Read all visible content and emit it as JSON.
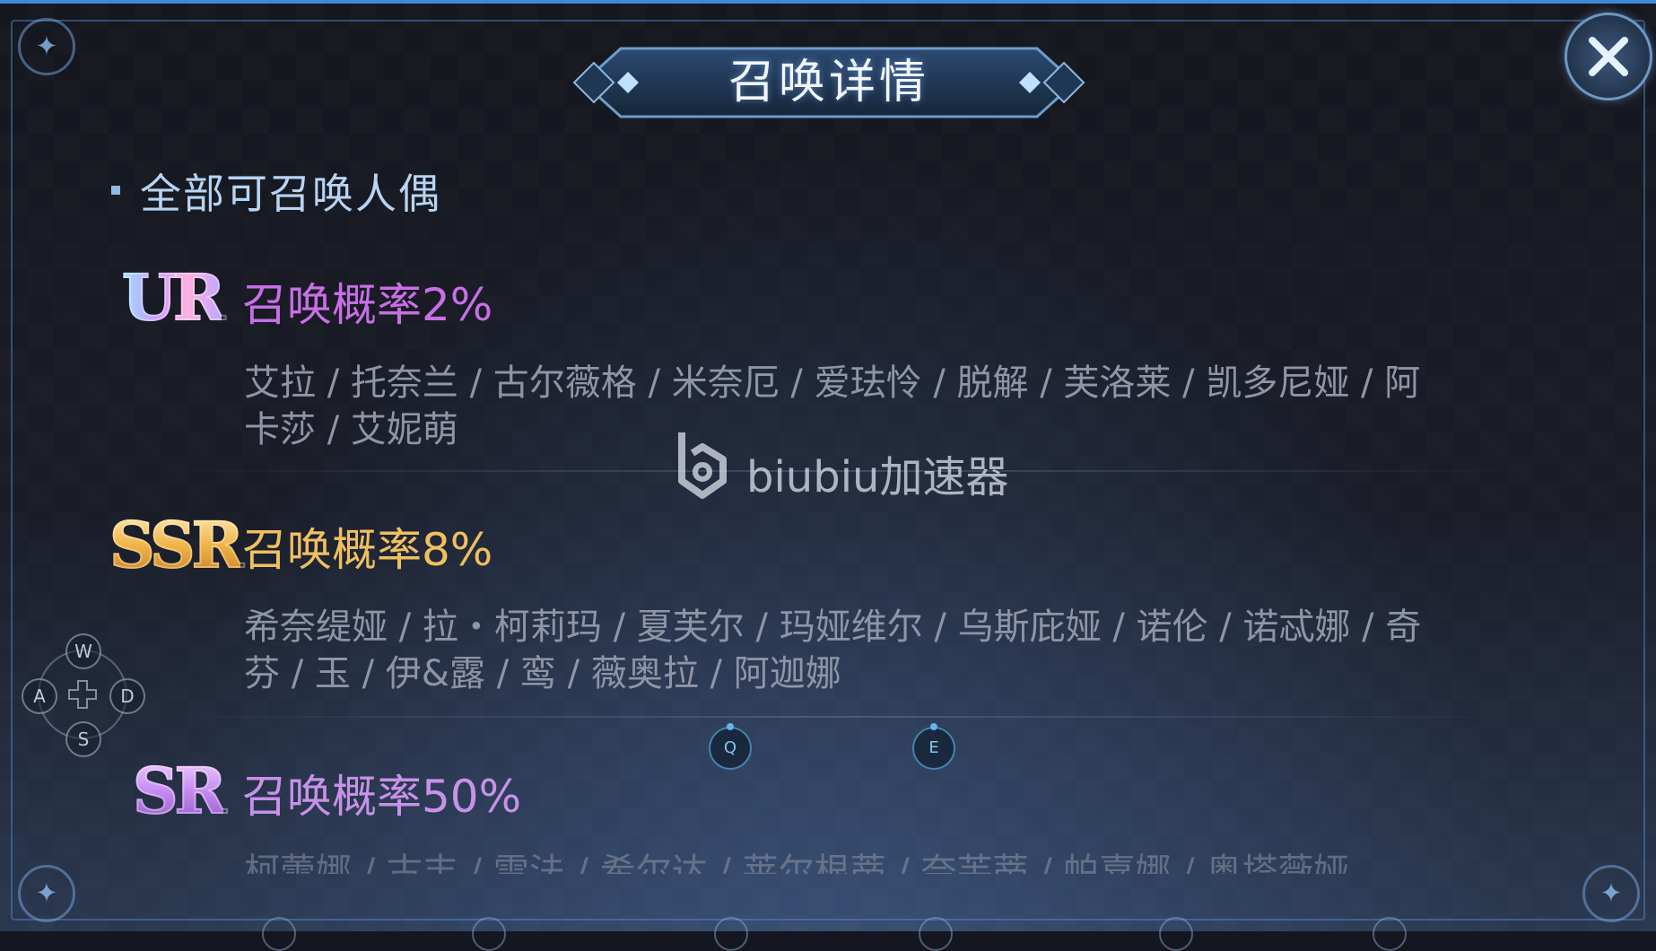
{
  "window": {
    "title": "召唤详情"
  },
  "section": {
    "heading": "全部可召唤人偶"
  },
  "tiers": [
    {
      "rank": "UR",
      "rate_label": "召唤概率2%",
      "names": "艾拉 / 托奈兰 / 古尔薇格 / 米奈厄 / 爱珐怜 / 脱解 / 芙洛莱 / 凯多尼娅 / 阿卡莎 / 艾妮萌",
      "color": "#c86fe6"
    },
    {
      "rank": "SSR",
      "rate_label": "召唤概率8%",
      "names": "希奈缇娅 / 拉・柯莉玛 / 夏芙尔 / 玛娅维尔 / 乌斯庇娅 / 诺伦 / 诺忒娜 / 奇芬 / 玉 / 伊&露 / 鸾 / 薇奥拉 / 阿迦娜",
      "color": "#f0c060"
    },
    {
      "rank": "SR",
      "rate_label": "召唤概率50%",
      "names": "柯蕾娜 / 古丰 / 雷法 / 希尔达 / 莱尔根蒂 / 奈芙蒂 / 帕嘉娜 / 奥塔薇娅",
      "color": "#c792e8"
    }
  ],
  "watermark": {
    "text": "biubiu加速器"
  },
  "controls": {
    "dpad": {
      "up": "W",
      "left": "A",
      "right": "D",
      "down": "S"
    },
    "hotkeys": {
      "q": "Q",
      "e": "E"
    }
  },
  "icons": {
    "close": "close-icon",
    "dpad": "dpad-cross-icon",
    "watermark_logo": "b-logo-icon",
    "corner": "star-emblem-icon"
  }
}
